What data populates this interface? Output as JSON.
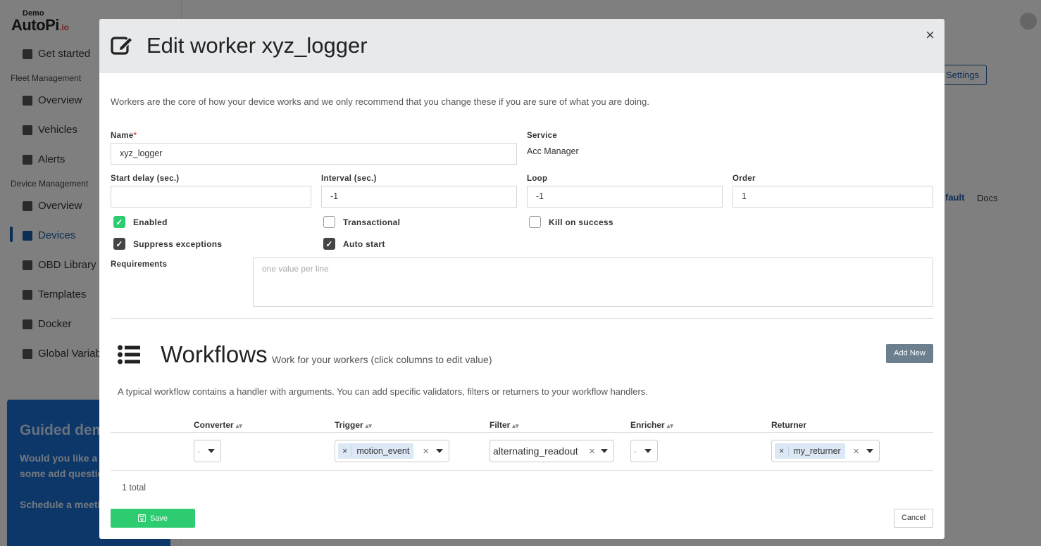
{
  "app": {
    "demo_label": "Demo",
    "logo_text": "AutoPi",
    "logo_suffix": ".io"
  },
  "sidebar": {
    "get_started": "Get started",
    "fleet_section": "Fleet Management",
    "fleet_items": [
      "Overview",
      "Vehicles",
      "Alerts"
    ],
    "device_section": "Device Management",
    "device_items": [
      "Overview",
      "Devices",
      "OBD Library",
      "Templates",
      "Docker",
      "Global Variabl"
    ]
  },
  "guide": {
    "title": "Guided dem",
    "text": "Would you like a g or have some add questions?",
    "text2": "Schedule a meeti directly."
  },
  "background": {
    "settings_button": "Settings",
    "default_link": "fault",
    "docs_link": "Docs"
  },
  "modal": {
    "title": "Edit worker xyz_logger",
    "close": "×",
    "intro": "Workers are the core of how your device works and we only recommend that you change these if you are sure of what you are doing.",
    "name_label": "Name",
    "name_value": "xyz_logger",
    "service_label": "Service",
    "service_value": "Acc Manager",
    "start_delay_label": "Start delay (sec.)",
    "start_delay_value": "",
    "interval_label": "Interval (sec.)",
    "interval_value": "-1",
    "loop_label": "Loop",
    "loop_value": "-1",
    "order_label": "Order",
    "order_value": "1",
    "checkboxes": {
      "enabled": {
        "label": "Enabled",
        "checked": true
      },
      "transactional": {
        "label": "Transactional",
        "checked": false
      },
      "kill_on_success": {
        "label": "Kill on success",
        "checked": false
      },
      "suppress_exceptions": {
        "label": "Suppress exceptions",
        "checked": true
      },
      "auto_start": {
        "label": "Auto start",
        "checked": true
      }
    },
    "requirements_label": "Requirements",
    "requirements_placeholder": "one value per line",
    "workflows": {
      "title": "Workflows",
      "subtitle": "Work for your workers (click columns to edit value)",
      "add_new": "Add New",
      "description": "A typical workflow contains a handler with arguments. You can add specific validators, filters or returners to your workflow handlers.",
      "columns": [
        "Converter",
        "Trigger",
        "Filter",
        "Enricher",
        "Returner"
      ],
      "row": {
        "converter": "-",
        "trigger": "motion_event",
        "filter": "alternating_readout",
        "enricher": "-",
        "returner": "my_returner"
      },
      "total": "1 total"
    },
    "save_label": "Save",
    "cancel_label": "Cancel"
  }
}
